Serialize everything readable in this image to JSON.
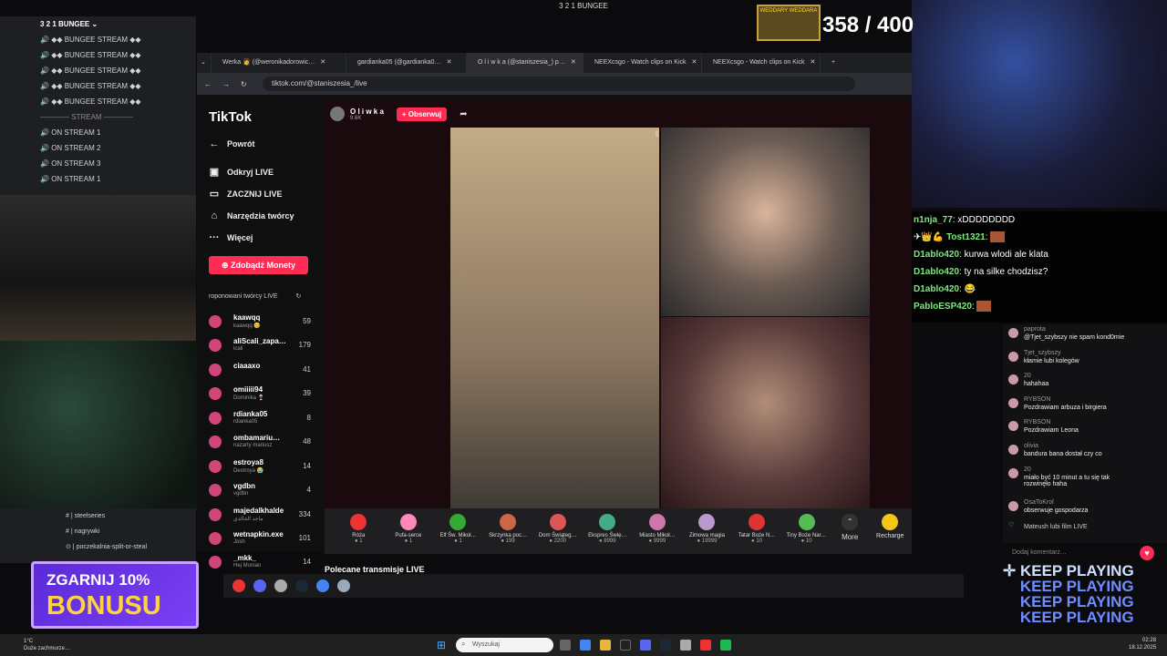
{
  "stream_title": "3 2 1 BUNGEE",
  "counter": "358 / 400",
  "wedding_badge": "WEDDARY WEDDARA",
  "discord": {
    "server_name": "3 2 1 BUNGEE",
    "channels": [
      "◆◆ BUNGEE STREAM ◆◆",
      "◆◆ BUNGEE STREAM ◆◆",
      "◆◆ BUNGEE STREAM ◆◆",
      "◆◆ BUNGEE STREAM ◆◆",
      "◆◆ BUNGEE STREAM ◆◆"
    ],
    "category": "STREAM",
    "on_stream": [
      "ON STREAM 1",
      "ON STREAM 2",
      "ON STREAM 3",
      "ON STREAM 1"
    ],
    "text_channels": [
      "steelseries",
      "nagrywki",
      "poczekalnia-split-or-steal"
    ]
  },
  "browser": {
    "tabs": [
      {
        "label": "Werka 👩 (@weronikadorowic…"
      },
      {
        "label": "gardianka05 (@gardianka0…"
      },
      {
        "label": "O l i w k a (@staniszesia_) p…"
      },
      {
        "label": "NEEXcsgo - Watch clips on Kick"
      },
      {
        "label": "NEEXcsgo - Watch clips on Kick"
      }
    ],
    "url": "tiktok.com/@staniszesia_/live"
  },
  "tiktok": {
    "logo": "TikTok",
    "nav": [
      "Powrót",
      "Odkryj LIVE",
      "ZACZNIJ LIVE",
      "Narzędzia twórcy",
      "Więcej"
    ],
    "coins_button": "Zdobądź Monety",
    "recommended_header": "roponowani twórcy LIVE",
    "creators": [
      {
        "name": "kaawqq",
        "sub": "kaawqq 😊",
        "count": "59"
      },
      {
        "name": "aliScali_zapa…",
        "sub": "icali",
        "count": "179"
      },
      {
        "name": "ciaaaxo",
        "sub": "",
        "count": "41"
      },
      {
        "name": "omiiiii94",
        "sub": "Dominika 🍷",
        "count": "39"
      },
      {
        "name": "rdianka05",
        "sub": "rdianka05",
        "count": "8"
      },
      {
        "name": "ombamariu…",
        "sub": "nazarty mariusz",
        "count": "48"
      },
      {
        "name": "estroya8",
        "sub": "Destroya 😭",
        "count": "14"
      },
      {
        "name": "vgdbn",
        "sub": "vgdbn",
        "count": "4"
      },
      {
        "name": "majedalkhalde",
        "sub": "ماجد الخالدي",
        "count": "334"
      },
      {
        "name": "wetnapkin.exe",
        "sub": "Josh",
        "count": "101"
      },
      {
        "name": "_mkk_",
        "sub": "Hej Monian",
        "count": "14"
      }
    ],
    "host": {
      "name": "O l i w k a",
      "followers": "9.6K",
      "follow_button": "+ Obserwuj"
    },
    "gifts": [
      {
        "name": "Róża",
        "price": "1",
        "color": "#e33"
      },
      {
        "name": "Pufa-serce",
        "price": "1",
        "color": "#f8b"
      },
      {
        "name": "Elf Św. Mikoł…",
        "price": "1",
        "color": "#3a3"
      },
      {
        "name": "Skrzynka poc…",
        "price": "199",
        "color": "#c64"
      },
      {
        "name": "Dom Świąteg…",
        "price": "2200",
        "color": "#d55"
      },
      {
        "name": "Ekspres Świę…",
        "price": "8999",
        "color": "#4a8"
      },
      {
        "name": "Miasto Mikoł…",
        "price": "9999",
        "color": "#c7a"
      },
      {
        "name": "Zimowa magia",
        "price": "19999",
        "color": "#b9c"
      },
      {
        "name": "Tatar Boże N…",
        "price": "10",
        "color": "#d33"
      },
      {
        "name": "Tiny Boże Nar…",
        "price": "10",
        "color": "#5b5"
      }
    ],
    "more": "More",
    "recharge": "Recharge",
    "recommended_live": "Polecane transmisje LIVE",
    "comment_placeholder": "Dodaj komentarz…",
    "comments": [
      {
        "user": "paprota",
        "text": "@Tjet_szybszy nie spam kond0mie"
      },
      {
        "user": "Tjet_szybszy",
        "text": "kłamie lubi kolegów"
      },
      {
        "user": "20",
        "text": "hahahaa"
      },
      {
        "user": "RYBSON",
        "text": "Pozdrawiam arbuza i birgiera"
      },
      {
        "user": "RYBSON",
        "text": "Pozdrawiam Leona"
      },
      {
        "user": "olivia",
        "text": "bandura bana dostał czy co"
      },
      {
        "user": "20",
        "text": "miało być 10 minut a tu się tak rozwinęło haha"
      },
      {
        "user": "OsaToKrol",
        "text": "obserwuje gospodarza"
      },
      {
        "user": "Mateush",
        "text": "lubi film LIVE"
      }
    ]
  },
  "stream_chat": [
    {
      "user": "n1nja_77",
      "text": "xDDDDDDDD"
    },
    {
      "user": "Tost1321",
      "text": ""
    },
    {
      "user": "D1ablo420",
      "text": "kurwa wlodi ale klata"
    },
    {
      "user": "D1ablo420",
      "text": "ty na silke chodzisz?"
    },
    {
      "user": "D1ablo420",
      "text": "😂"
    },
    {
      "user": "PabloESP420",
      "text": ""
    }
  ],
  "bonus": {
    "line1": "ZGARNIJ 10%",
    "line2": "BONUSU"
  },
  "keep_playing": [
    "KEEP PLAYING",
    "KEEP PLAYING",
    "KEEP PLAYING",
    "KEEP PLAYING"
  ],
  "taskbar": {
    "search_placeholder": "Wyszukaj",
    "weather_temp": "1°C",
    "weather_desc": "Duże zachmurze…",
    "time": "02:28",
    "date": "18.12.2025"
  }
}
